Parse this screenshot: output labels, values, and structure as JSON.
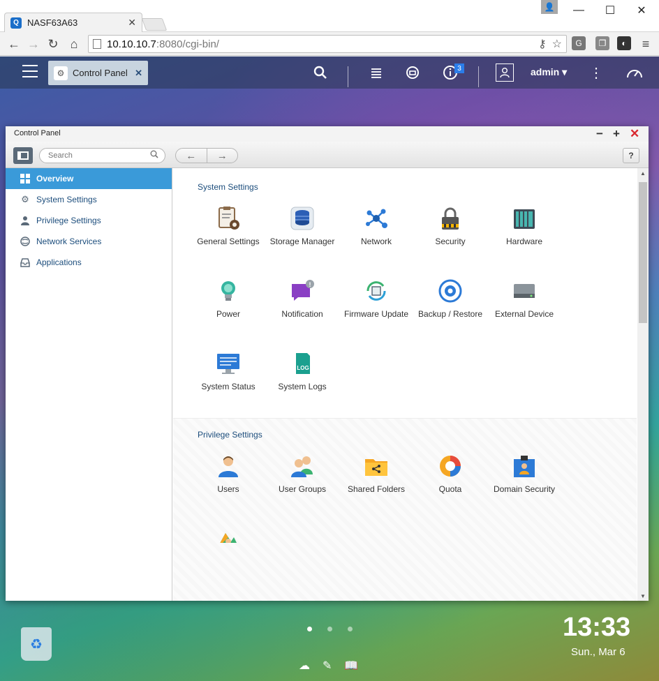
{
  "browser": {
    "tab_title": "NASF63A63",
    "tab_close": "✕",
    "favicon": "Q",
    "url_host": "10.10.10.7",
    "url_rest": ":8080/cgi-bin/",
    "window_controls": {
      "minimize": "—",
      "maximize": "☐",
      "close": "✕"
    }
  },
  "nas_topbar": {
    "active_app_tab": "Control Panel",
    "notification_count": "3",
    "user": "admin",
    "user_caret": "▾"
  },
  "control_panel": {
    "window_title": "Control Panel",
    "search_placeholder": "Search",
    "help_label": "?",
    "sidebar": [
      {
        "label": "Overview",
        "icon": "grid-icon",
        "active": true
      },
      {
        "label": "System Settings",
        "icon": "gear-icon",
        "active": false
      },
      {
        "label": "Privilege Settings",
        "icon": "user-icon",
        "active": false
      },
      {
        "label": "Network Services",
        "icon": "globe-icon",
        "active": false
      },
      {
        "label": "Applications",
        "icon": "inbox-icon",
        "active": false
      }
    ],
    "system_settings": {
      "title": "System Settings",
      "items": [
        {
          "label": "General Settings",
          "icon": "general-settings-icon"
        },
        {
          "label": "Storage Manager",
          "icon": "storage-icon"
        },
        {
          "label": "Network",
          "icon": "network-icon"
        },
        {
          "label": "Security",
          "icon": "lock-icon"
        },
        {
          "label": "Hardware",
          "icon": "hardware-icon"
        },
        {
          "label": "Power",
          "icon": "bulb-icon"
        },
        {
          "label": "Notification",
          "icon": "notification-icon"
        },
        {
          "label": "Firmware Update",
          "icon": "firmware-icon"
        },
        {
          "label": "Backup / Restore",
          "icon": "backup-icon"
        },
        {
          "label": "External Device",
          "icon": "external-drive-icon"
        },
        {
          "label": "System Status",
          "icon": "monitor-icon"
        },
        {
          "label": "System Logs",
          "icon": "log-icon"
        }
      ]
    },
    "privilege_settings": {
      "title": "Privilege Settings",
      "items": [
        {
          "label": "Users",
          "icon": "user-icon"
        },
        {
          "label": "User Groups",
          "icon": "user-group-icon"
        },
        {
          "label": "Shared Folders",
          "icon": "shared-folder-icon"
        },
        {
          "label": "Quota",
          "icon": "quota-pie-icon"
        },
        {
          "label": "Domain Security",
          "icon": "domain-security-icon"
        }
      ]
    }
  },
  "desktop": {
    "time": "13:33",
    "date": "Sun., Mar 6",
    "page_dots": 3
  },
  "colors": {
    "accent": "#3a9ad9",
    "section_title": "#1c4d7c",
    "close_red": "#d9282f"
  }
}
